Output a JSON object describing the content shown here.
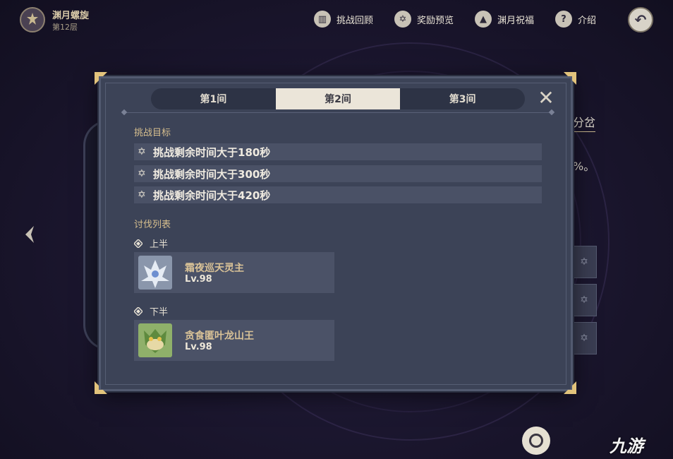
{
  "header": {
    "title": "渊月螺旋",
    "floor": "第12层"
  },
  "nav": {
    "review": "挑战回顾",
    "reward": "奖励预览",
    "blessing": "渊月祝福",
    "intro": "介绍"
  },
  "background": {
    "text1": "分岔",
    "text2": "%。"
  },
  "tabs": [
    "第1间",
    "第2间",
    "第3间"
  ],
  "active_tab": 1,
  "challenge": {
    "title": "挑战目标",
    "goals": [
      "挑战剩余时间大于180秒",
      "挑战剩余时间大于300秒",
      "挑战剩余时间大于420秒"
    ]
  },
  "enemy_list": {
    "title": "讨伐列表",
    "first_half": {
      "label": "上半",
      "name": "霜夜巡天灵主",
      "level": "Lv.98"
    },
    "second_half": {
      "label": "下半",
      "name": "贪食匿叶龙山王",
      "level": "Lv.98"
    }
  },
  "watermark": "九游",
  "colors": {
    "panel": "#3c4357",
    "active_tab": "#ebe5d9",
    "section_title": "#d7bf8e",
    "enemy_name": "#d9c297"
  }
}
